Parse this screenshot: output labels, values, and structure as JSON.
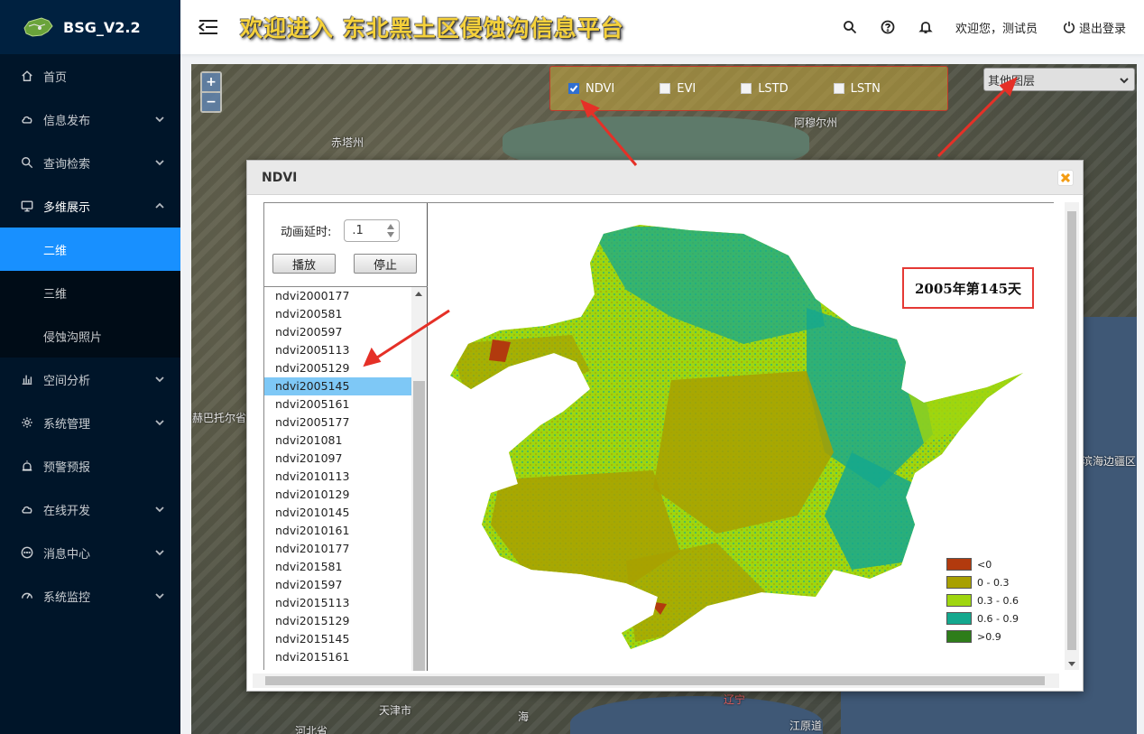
{
  "app": {
    "logo_text": "BSG_V2.2"
  },
  "sidebar": {
    "items": [
      {
        "label": "首页",
        "icon": "home-icon",
        "has_children": false
      },
      {
        "label": "信息发布",
        "icon": "cloud-icon",
        "has_children": true
      },
      {
        "label": "查询检索",
        "icon": "search-icon",
        "has_children": true
      },
      {
        "label": "多维展示",
        "icon": "monitor-icon",
        "has_children": true,
        "open": true,
        "children": [
          {
            "label": "二维",
            "active": true
          },
          {
            "label": "三维",
            "active": false
          },
          {
            "label": "侵蚀沟照片",
            "active": false
          }
        ]
      },
      {
        "label": "空间分析",
        "icon": "bar-chart-icon",
        "has_children": true
      },
      {
        "label": "系统管理",
        "icon": "gear-icon",
        "has_children": true
      },
      {
        "label": "预警预报",
        "icon": "alarm-icon",
        "has_children": false
      },
      {
        "label": "在线开发",
        "icon": "cloud-icon",
        "has_children": true
      },
      {
        "label": "消息中心",
        "icon": "message-icon",
        "has_children": true
      },
      {
        "label": "系统监控",
        "icon": "dashboard-icon",
        "has_children": true
      }
    ]
  },
  "header": {
    "title": "欢迎进入 东北黑土区侵蚀沟信息平台",
    "welcome": "欢迎您，测试员",
    "logout": "退出登录"
  },
  "map": {
    "layers": [
      {
        "label": "NDVI",
        "checked": true
      },
      {
        "label": "EVI",
        "checked": false
      },
      {
        "label": "LSTD",
        "checked": false
      },
      {
        "label": "LSTN",
        "checked": false
      }
    ],
    "other_layers_select": "其他图层",
    "labels": [
      "赤塔州",
      "阿穆尔州",
      "赫巴托尔省",
      "滨海边疆区",
      "天津市",
      "河北省",
      "辽宁",
      "江原道",
      "海"
    ]
  },
  "dialog": {
    "title": "NDVI",
    "delay_label": "动画延时:",
    "delay_value": ".1",
    "play_label": "播放",
    "stop_label": "停止",
    "date_list": [
      "ndvi2000177",
      "ndvi200581",
      "ndvi200597",
      "ndvi2005113",
      "ndvi2005129",
      "ndvi2005145",
      "ndvi2005161",
      "ndvi2005177",
      "ndvi201081",
      "ndvi201097",
      "ndvi2010113",
      "ndvi2010129",
      "ndvi2010145",
      "ndvi2010161",
      "ndvi2010177",
      "ndvi201581",
      "ndvi201597",
      "ndvi2015113",
      "ndvi2015129",
      "ndvi2015145",
      "ndvi2015161"
    ],
    "selected_index": 5,
    "date_caption": "2005年第145天",
    "legend": [
      {
        "label": "<0",
        "color": "#b23a0e"
      },
      {
        "label": "0 - 0.3",
        "color": "#a8a000"
      },
      {
        "label": "0.3 - 0.6",
        "color": "#9fd60f"
      },
      {
        "label": "0.6 - 0.9",
        "color": "#14a88e"
      },
      {
        "label": ">0.9",
        "color": "#2e7d1a"
      }
    ]
  }
}
